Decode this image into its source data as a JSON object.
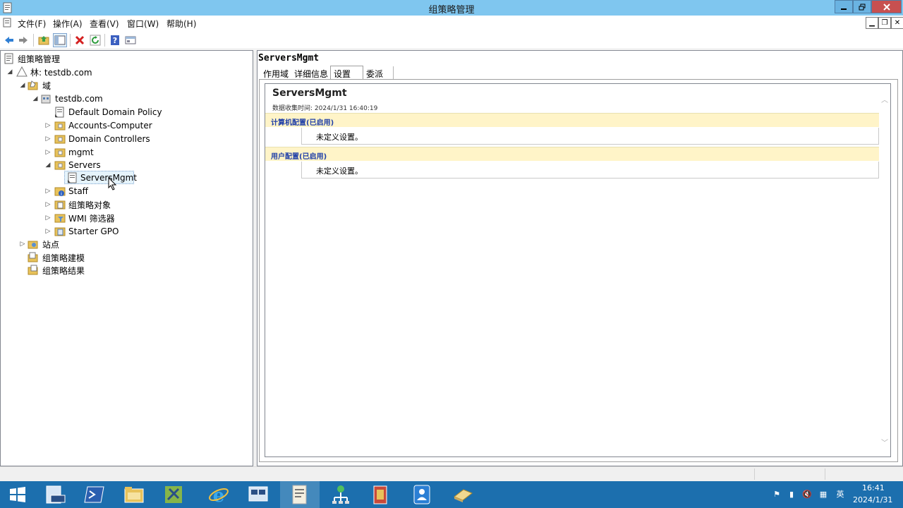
{
  "window": {
    "title": "组策略管理"
  },
  "colors": {
    "titlebar": "#7fc6ef",
    "close": "#c75050",
    "taskbar": "#1c6fae",
    "section_bg": "#fff4c8",
    "section_text": "#1f3fa8"
  },
  "menu": [
    "文件(F)",
    "操作(A)",
    "查看(V)",
    "窗口(W)",
    "帮助(H)"
  ],
  "toolbar_icons": [
    "back-icon",
    "forward-icon",
    "up-folder-icon",
    "show-hide-tree-icon",
    "delete-icon",
    "refresh-icon",
    "help-icon",
    "properties-icon"
  ],
  "tree": {
    "root": "组策略管理",
    "forest": "林: testdb.com",
    "domains": "域",
    "domain": "testdb.com",
    "items": {
      "default_policy": "Default Domain Policy",
      "accounts": "Accounts-Computer",
      "dcs": "Domain Controllers",
      "mgmt": "mgmt",
      "servers": "Servers",
      "servers_mgmt": "ServersMgmt",
      "staff": "Staff",
      "gpo": "组策略对象",
      "wmi": "WMI 筛选器",
      "starter": "Starter GPO"
    },
    "sites": "站点",
    "modeling": "组策略建模",
    "results": "组策略结果"
  },
  "detail": {
    "title": "ServersMgmt",
    "tabs": [
      "作用域",
      "详细信息",
      "设置",
      "委派"
    ],
    "active_tab": "设置",
    "report_title": "ServersMgmt",
    "data_collected": "数据收集时间: 2024/1/31 16:40:19",
    "sections": [
      {
        "header": "计算机配置(已启用)",
        "body": "未定义设置。"
      },
      {
        "header": "用户配置(已启用)",
        "body": "未定义设置。"
      }
    ]
  },
  "taskbar": {
    "apps": [
      "start-icon",
      "server-manager-icon",
      "powershell-icon",
      "file-explorer-icon",
      "tools-icon",
      "internet-explorer-icon",
      "remote-desktop-icon",
      "group-policy-icon",
      "network-icon",
      "book-icon",
      "address-book-icon",
      "notepad-icon"
    ],
    "time": "16:41",
    "date": "2024/1/31"
  }
}
